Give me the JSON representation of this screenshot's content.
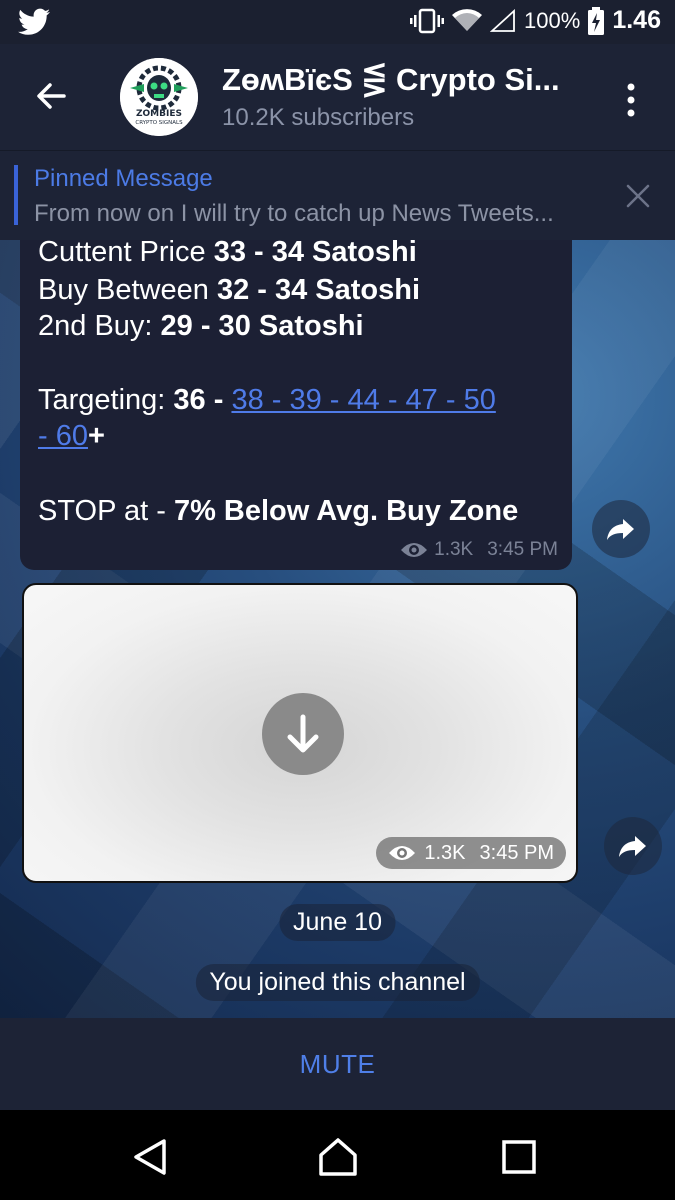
{
  "status_bar": {
    "app_icon": "twitter-icon",
    "battery": "100%",
    "time": "1.46"
  },
  "header": {
    "title": "ZɵʍBïєS ⋚ Crypto Si...",
    "subscribers": "10.2K subscribers",
    "avatar_text": "ZOMBIES",
    "avatar_subtext": "CRYPTO SIGNALS"
  },
  "pinned": {
    "label": "Pinned Message",
    "text": "From now on I will try to catch up News Tweets..."
  },
  "message": {
    "l1_prefix": "Cuttent Price ",
    "l1_value": "33 - 34 Satoshi",
    "l2_prefix": "Buy Between ",
    "l2_value": "32 - 34 Satoshi",
    "l3_prefix": "2nd Buy: ",
    "l3_value": "29 - 30 Satoshi",
    "target_prefix": "Targeting: ",
    "target_first": "36 - ",
    "target_link_1": "38 - 39 - 44 - 47 - 50",
    "target_link_2": "- 60",
    "target_suffix": "+",
    "stop_prefix": "STOP at - ",
    "stop_value": "7% Below Avg. Buy Zone",
    "views": "1.3K",
    "time": "3:45 PM"
  },
  "media": {
    "views": "1.3K",
    "time": "3:45 PM"
  },
  "date_pill": "June 10",
  "service_message": "You joined this channel",
  "bottom": {
    "mute_label": "MUTE"
  },
  "colors": {
    "accent": "#4f7fe8",
    "header_bg": "#1d2336",
    "bubble_bg": "#1c2034"
  }
}
